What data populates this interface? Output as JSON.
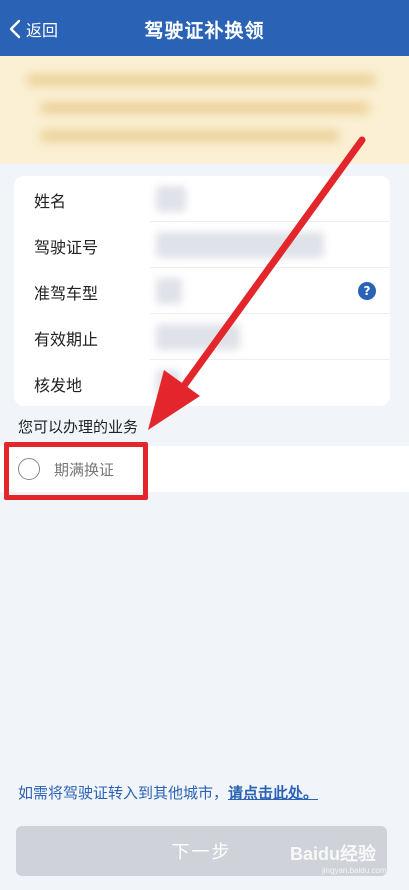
{
  "header": {
    "back_label": "返回",
    "title": "驾驶证补换领"
  },
  "info_card": {
    "rows": [
      {
        "label": "姓名"
      },
      {
        "label": "驾驶证号"
      },
      {
        "label": "准驾车型"
      },
      {
        "label": "有效期止"
      },
      {
        "label": "核发地"
      }
    ],
    "help_glyph": "?"
  },
  "business": {
    "section_title": "您可以办理的业务",
    "options": [
      {
        "label": "期满换证",
        "selected": false
      }
    ]
  },
  "transfer": {
    "text": "如需将驾驶证转入到其他城市，",
    "link_text": "请点击此处。"
  },
  "footer": {
    "next_label": "下一步"
  },
  "watermark": {
    "brand": "Baidu经验",
    "url": "jingyan.baidu.com"
  },
  "colors": {
    "header_bg": "#2a62b5",
    "banner_bg": "#fbf0d3",
    "annotation_red": "#e3262b",
    "link_blue": "#2a62b5",
    "disabled_button": "#cfd2d8"
  }
}
